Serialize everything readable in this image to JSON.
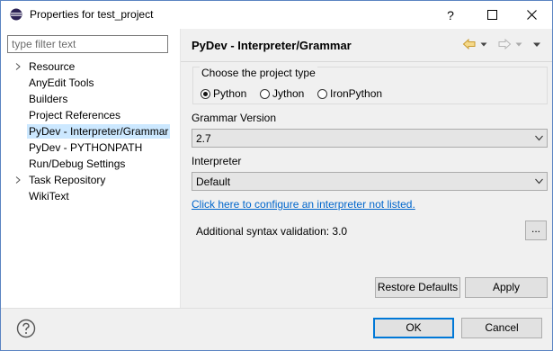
{
  "window": {
    "title": "Properties for test_project",
    "help_glyph": "?",
    "maximize_glyph": "□",
    "close_glyph": "✕"
  },
  "filter": {
    "placeholder": "type filter text",
    "value": ""
  },
  "tree": {
    "items": [
      {
        "label": "Resource",
        "expandable": true
      },
      {
        "label": "AnyEdit Tools",
        "expandable": false
      },
      {
        "label": "Builders",
        "expandable": false
      },
      {
        "label": "Project References",
        "expandable": false
      },
      {
        "label": "PyDev - Interpreter/Grammar",
        "expandable": false,
        "selected": true
      },
      {
        "label": "PyDev - PYTHONPATH",
        "expandable": false
      },
      {
        "label": "Run/Debug Settings",
        "expandable": false
      },
      {
        "label": "Task Repository",
        "expandable": true
      },
      {
        "label": "WikiText",
        "expandable": false
      }
    ]
  },
  "page": {
    "title": "PyDev - Interpreter/Grammar",
    "project_type": {
      "legend": "Choose the project type",
      "options": [
        "Python",
        "Jython",
        "IronPython"
      ],
      "selected": "Python"
    },
    "grammar": {
      "label": "Grammar Version",
      "value": "2.7"
    },
    "interpreter": {
      "label": "Interpreter",
      "value": "Default"
    },
    "configure_link": "Click here to configure an interpreter not listed.",
    "syntax_validation": "Additional syntax validation: 3.0",
    "dots_label": "...",
    "restore_defaults": "Restore Defaults",
    "apply": "Apply"
  },
  "footer": {
    "ok": "OK",
    "cancel": "Cancel"
  },
  "colors": {
    "selection": "#cce8ff",
    "link": "#0066cc",
    "default_button_border": "#0078d7",
    "nav_back": "#e0b050"
  }
}
